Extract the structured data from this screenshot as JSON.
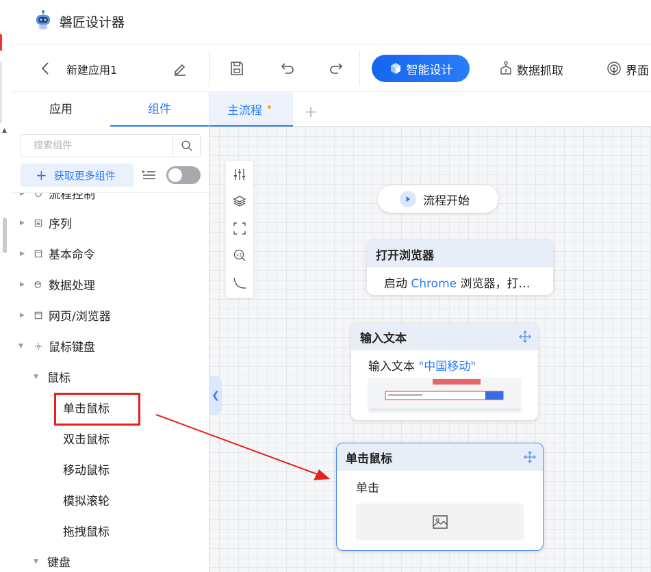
{
  "app": {
    "title": "磐匠设计器"
  },
  "toolbar": {
    "app_name": "新建应用1",
    "smart_design_label": "智能设计",
    "data_scrape_label": "数据抓取",
    "ui_label": "界面"
  },
  "left_panel": {
    "tabs": [
      {
        "label": "应用"
      },
      {
        "label": "组件"
      }
    ],
    "search_placeholder": "搜索组件",
    "get_more_label": "获取更多组件",
    "tree": {
      "partial_top": "流程控制",
      "items": [
        {
          "label": "序列"
        },
        {
          "label": "基本命令"
        },
        {
          "label": "数据处理"
        },
        {
          "label": "网页/浏览器"
        },
        {
          "label": "鼠标键盘"
        }
      ],
      "mouse_group": "鼠标",
      "mouse_items": [
        {
          "label": "单击鼠标"
        },
        {
          "label": "双击鼠标"
        },
        {
          "label": "移动鼠标"
        },
        {
          "label": "模拟滚轮"
        },
        {
          "label": "拖拽鼠标"
        }
      ],
      "keyboard_group": "键盘"
    }
  },
  "canvas": {
    "tab_label": "主流程",
    "start_label": "流程开始",
    "nodes": [
      {
        "title": "打开浏览器",
        "body_prefix": "启动 ",
        "body_highlight": "Chrome",
        "body_suffix": " 浏览器，打…"
      },
      {
        "title": "输入文本",
        "body_prefix": "输入文本 ",
        "body_highlight": "\"中国移动\""
      },
      {
        "title": "单击鼠标",
        "body": "单击"
      }
    ]
  },
  "colors": {
    "accent": "#2b7cf7",
    "highlight_box": "#e8201b"
  }
}
